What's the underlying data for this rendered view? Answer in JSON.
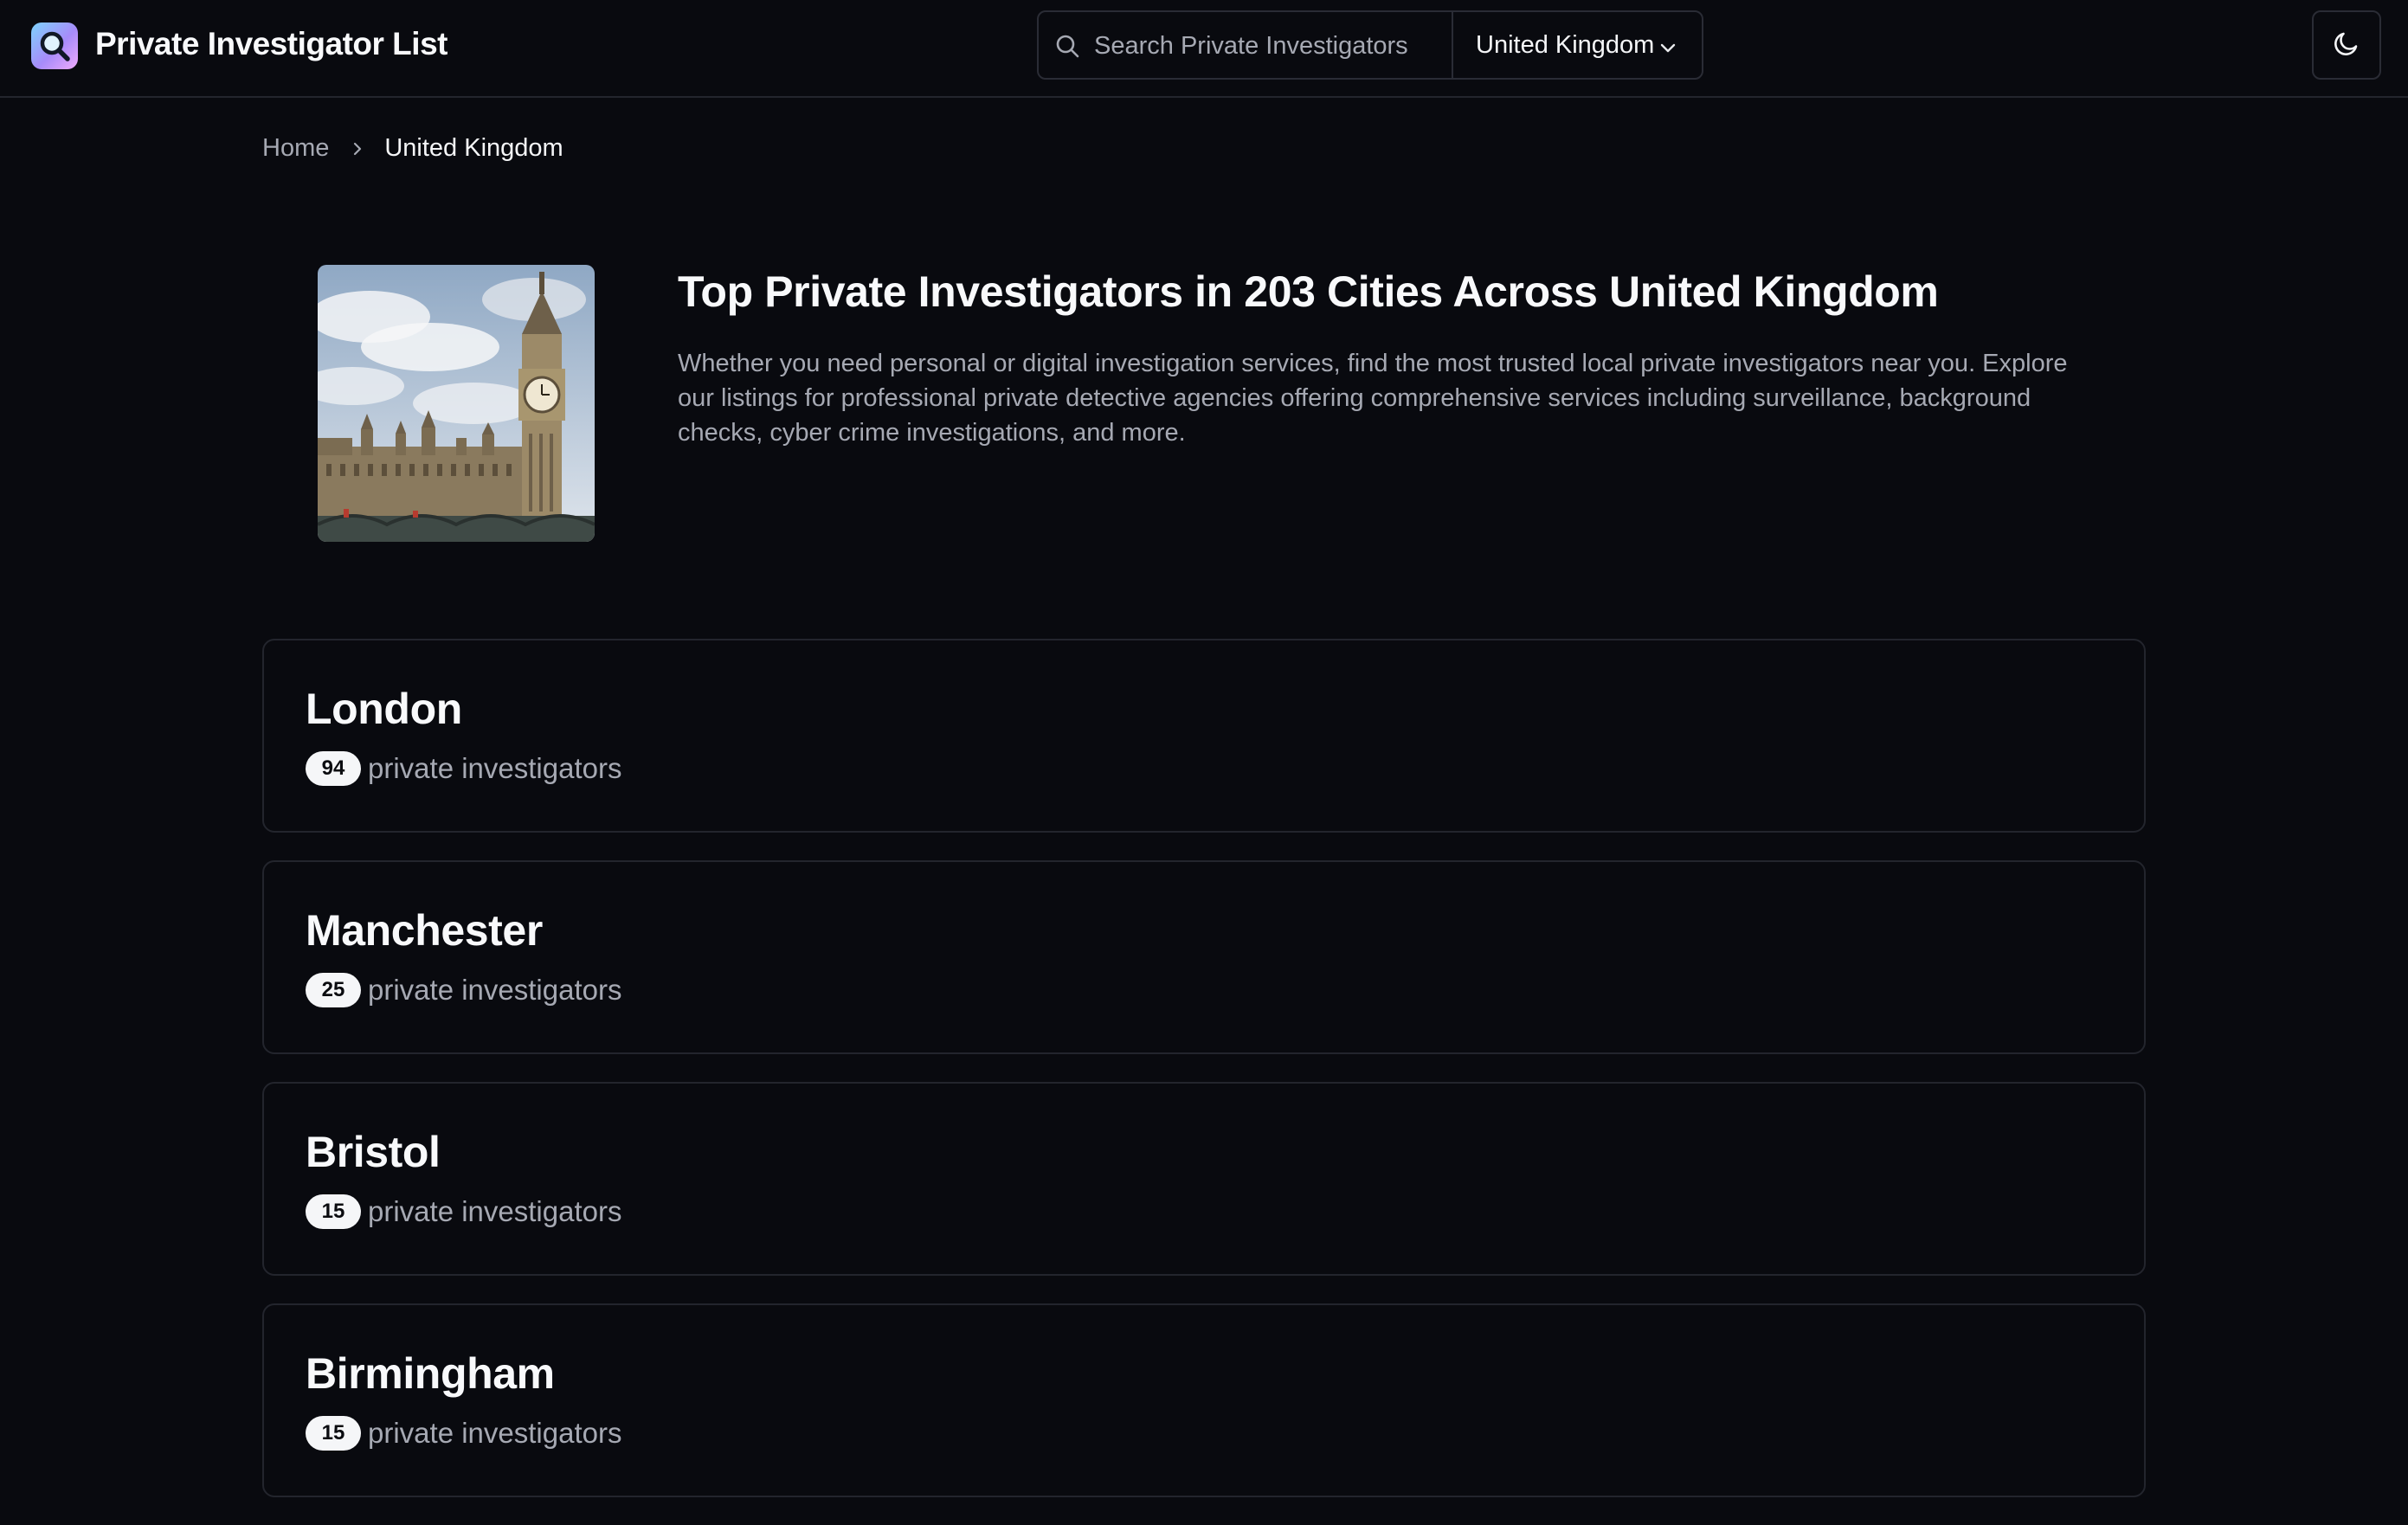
{
  "header": {
    "brand": "Private Investigator List",
    "search_placeholder": "Search Private Investigators",
    "country": "United Kingdom",
    "icons": {
      "logo": "magnifier-logo-icon",
      "search": "search-icon",
      "country": "chevron-down-icon",
      "theme": "moon-icon"
    }
  },
  "breadcrumb": {
    "home": "Home",
    "current": "United Kingdom"
  },
  "hero": {
    "image": "big-ben-westminster-photo",
    "title": "Top Private Investigators in 203 Cities Across United Kingdom",
    "description": "Whether you need personal or digital investigation services, find the most trusted local private investigators near you. Explore our listings for professional private detective agencies offering comprehensive services including surveillance, background checks, cyber crime investigations, and more."
  },
  "cities": [
    {
      "name": "London",
      "count": "94",
      "label": "private investigators"
    },
    {
      "name": "Manchester",
      "count": "25",
      "label": "private investigators"
    },
    {
      "name": "Bristol",
      "count": "15",
      "label": "private investigators"
    },
    {
      "name": "Birmingham",
      "count": "15",
      "label": "private investigators"
    }
  ],
  "colors": {
    "background": "#090a0f",
    "border": "#23252d",
    "text_primary": "#f5f6f8",
    "text_muted": "#a6a9b3",
    "badge_bg": "#f5f6f8"
  }
}
